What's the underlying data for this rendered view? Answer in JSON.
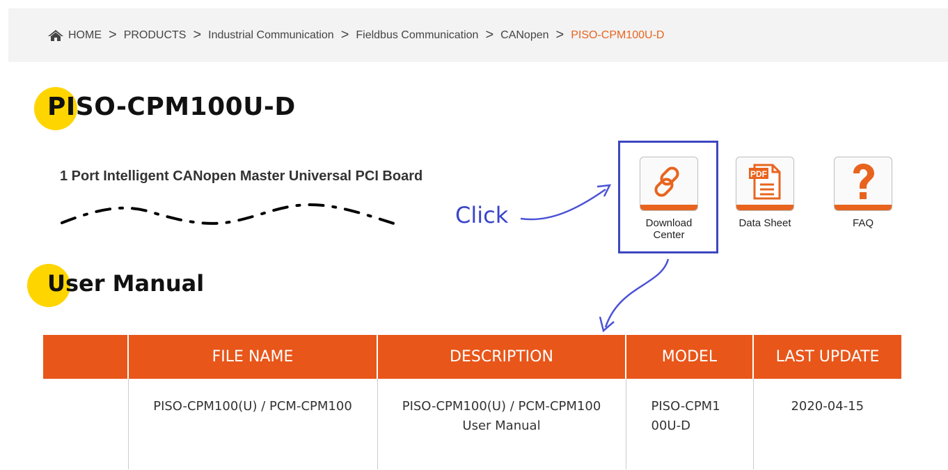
{
  "breadcrumb": {
    "items": [
      "HOME",
      "PRODUCTS",
      "Industrial Communication",
      "Fieldbus Communication",
      "CANopen",
      "PISO-CPM100U-D"
    ],
    "separator": ">"
  },
  "product": {
    "title": "PISO-CPM100U-D",
    "subtitle": "1 Port Intelligent CANopen Master Universal PCI Board"
  },
  "annotation": {
    "click_label": "Click"
  },
  "icon_buttons": [
    {
      "label": "Download Center",
      "icon": "link-icon"
    },
    {
      "label": "Data Sheet",
      "icon": "pdf-icon"
    },
    {
      "label": "FAQ",
      "icon": "question-icon"
    }
  ],
  "user_manual": {
    "title": "User Manual",
    "columns": [
      "",
      "FILE NAME",
      "DESCRIPTION",
      "MODEL",
      "LAST UPDATE"
    ],
    "rows": [
      {
        "file_name": "PISO-CPM100(U) / PCM-CPM100",
        "description": "PISO-CPM100(U) / PCM-CPM100 User Manual",
        "model": "PISO-CPM100U-D",
        "last_update": "2020-04-15"
      }
    ]
  },
  "colors": {
    "accent": "#e8641e",
    "table_header": "#e8561a",
    "title_dot": "#ffd500",
    "annotation": "#3c46c0"
  }
}
